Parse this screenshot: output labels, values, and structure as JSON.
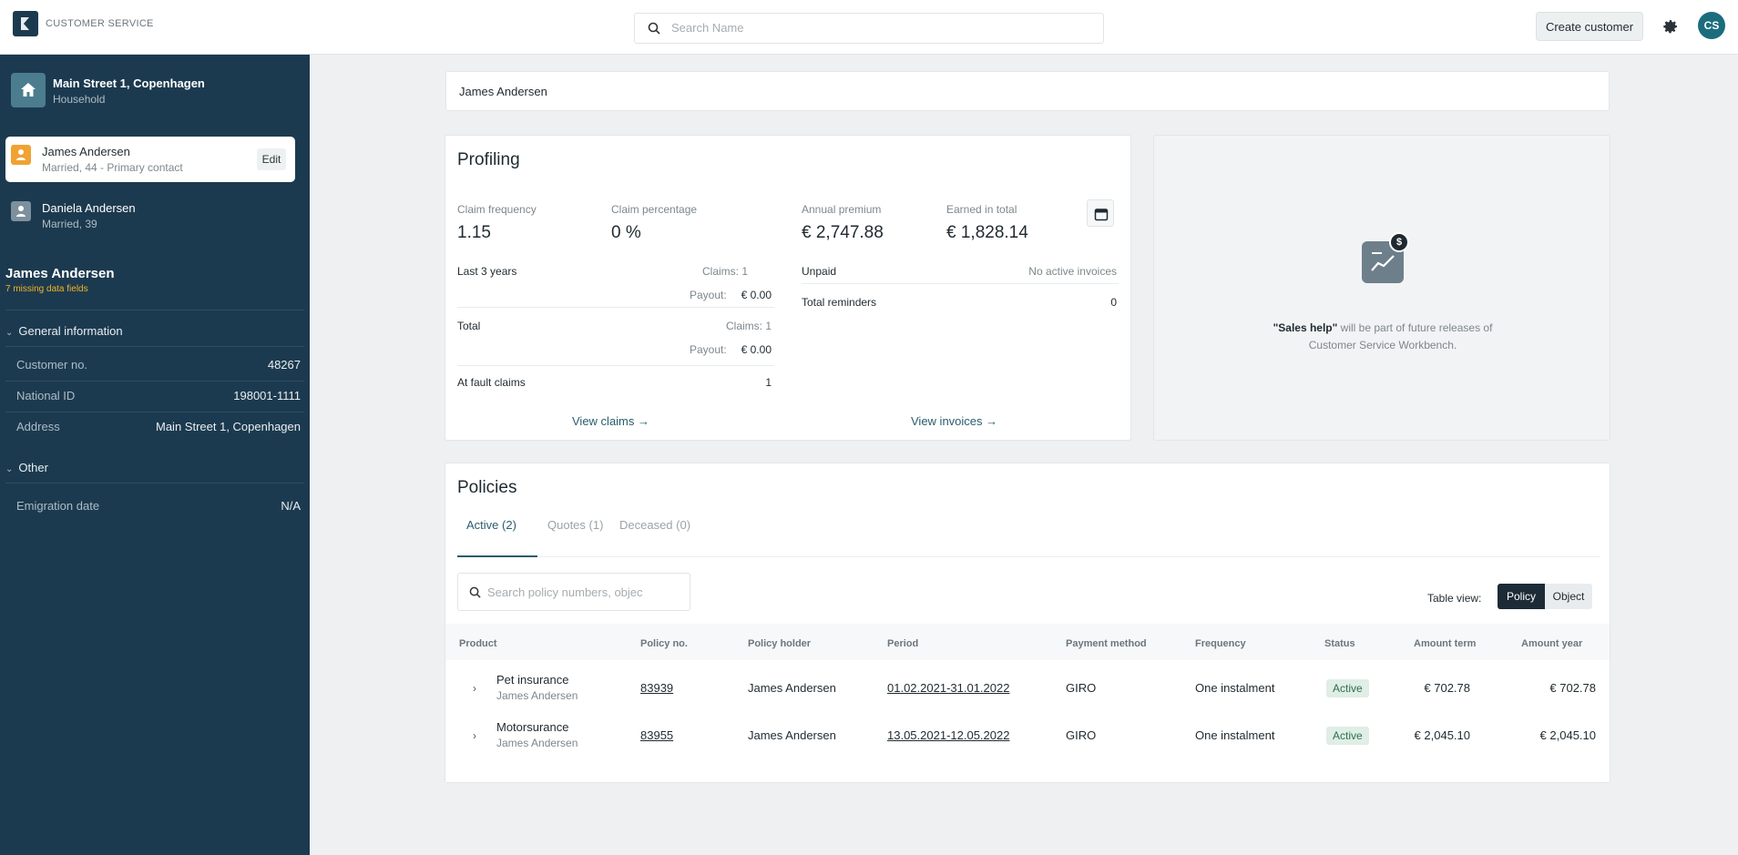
{
  "app": {
    "name": "CUSTOMER SERVICE"
  },
  "topbar": {
    "search_placeholder": "Search Name",
    "create_label": "Create customer",
    "avatar_initials": "CS"
  },
  "sidebar": {
    "household": {
      "address": "Main Street 1, Copenhagen",
      "label": "Household"
    },
    "members": [
      {
        "name": "James Andersen",
        "detail": "Married, 44 - Primary contact",
        "edit_label": "Edit"
      },
      {
        "name": "Daniela Andersen",
        "detail": "Married, 39"
      }
    ],
    "person": {
      "name": "James Andersen",
      "missing": "7 missing data fields"
    },
    "general": {
      "title": "General information",
      "rows": [
        {
          "key": "Customer no.",
          "value": "48267"
        },
        {
          "key": "National ID",
          "value": "198001-1111"
        },
        {
          "key": "Address",
          "value": "Main Street 1, Copenhagen"
        }
      ]
    },
    "other": {
      "title": "Other",
      "rows": [
        {
          "key": "Emigration date",
          "value": "N/A"
        }
      ]
    }
  },
  "main": {
    "customer_name": "James Andersen",
    "profiling": {
      "title": "Profiling",
      "metrics": [
        {
          "label": "Claim frequency",
          "value": "1.15"
        },
        {
          "label": "Claim percentage",
          "value": "0 %"
        },
        {
          "label": "Annual premium",
          "value": "€ 2,747.88"
        },
        {
          "label": "Earned in total",
          "value": "€ 1,828.14"
        }
      ],
      "last3": {
        "label": "Last 3 years",
        "claims": "Claims: 1",
        "payout_label": "Payout:",
        "payout": "€ 0.00"
      },
      "total": {
        "label": "Total",
        "claims": "Claims: 1",
        "payout_label": "Payout:",
        "payout": "€ 0.00"
      },
      "at_fault": {
        "label": "At fault claims",
        "value": "1"
      },
      "unpaid": {
        "label": "Unpaid",
        "value": "No active invoices"
      },
      "reminders": {
        "label": "Total reminders",
        "value": "0"
      },
      "view_claims": "View claims →",
      "view_invoices": "View invoices →"
    },
    "sales": {
      "bold": "\"Sales help\"",
      "line1": " will be part of future releases of",
      "line2": "Customer Service Workbench."
    },
    "policies": {
      "title": "Policies",
      "tabs": [
        "Active (2)",
        "Quotes (1)",
        "Deceased (0)"
      ],
      "search_placeholder": "Search policy numbers, objec",
      "table_view_label": "Table view:",
      "view_policy": "Policy",
      "view_object": "Object",
      "columns": [
        "Product",
        "Policy no.",
        "Policy holder",
        "Period",
        "Payment method",
        "Frequency",
        "Status",
        "Amount term",
        "Amount year"
      ],
      "rows": [
        {
          "product": "Pet insurance",
          "holder_sub": "James Andersen",
          "policy_no": "83939",
          "holder": "James Andersen",
          "period": "01.02.2021-31.01.2022",
          "payment": "GIRO",
          "frequency": "One instalment",
          "status": "Active",
          "amount_term": "€ 702.78",
          "amount_year": "€ 702.78"
        },
        {
          "product": "Motorsurance",
          "holder_sub": "James Andersen",
          "policy_no": "83955",
          "holder": "James Andersen",
          "period": "13.05.2021-12.05.2022",
          "payment": "GIRO",
          "frequency": "One instalment",
          "status": "Active",
          "amount_term": "€ 2,045.10",
          "amount_year": "€ 2,045.10"
        }
      ]
    }
  }
}
